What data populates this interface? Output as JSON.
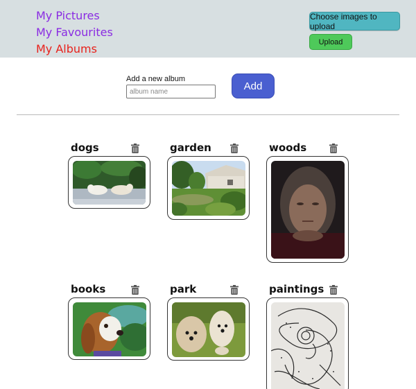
{
  "nav": {
    "pictures": "My Pictures",
    "favourites": "My Favourites",
    "albums": "My Albums"
  },
  "upload": {
    "choose_label": "Choose images to upload",
    "upload_label": "Upload"
  },
  "new_album": {
    "label": "Add a new album",
    "placeholder": "album name",
    "value": "",
    "add_label": "Add"
  },
  "albums": [
    {
      "title": "dogs",
      "thumb": "dogs-photo"
    },
    {
      "title": "garden",
      "thumb": "garden-photo"
    },
    {
      "title": "woods",
      "thumb": "woods-photo"
    },
    {
      "title": "books",
      "thumb": "books-photo"
    },
    {
      "title": "park",
      "thumb": "park-photo"
    },
    {
      "title": "paintings",
      "thumb": "paintings-photo"
    }
  ],
  "icons": {
    "delete": "trash-icon"
  },
  "colors": {
    "header_bg": "#d7dfe1",
    "nav_link": "#8a2be2",
    "nav_active": "#e8221c",
    "choose_button": "#50b6c1",
    "upload_button": "#4ec95a",
    "add_button": "#4a5fd0"
  }
}
